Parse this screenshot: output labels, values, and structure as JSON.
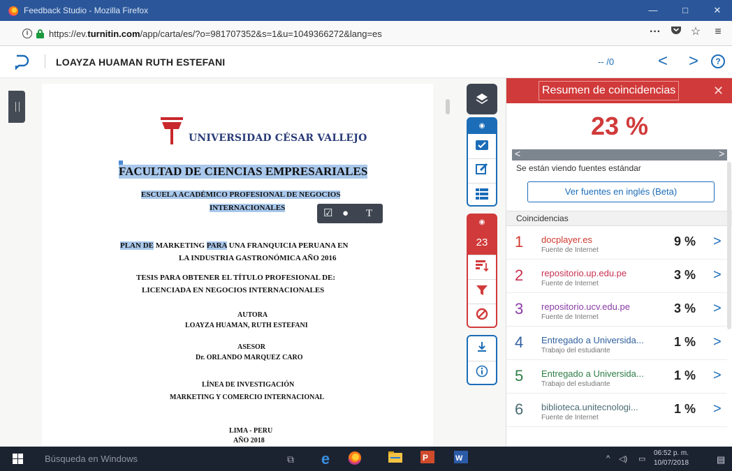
{
  "window": {
    "title": "Feedback Studio - Mozilla Firefox",
    "controls": {
      "minimize": "—",
      "maximize": "□",
      "close": "✕"
    }
  },
  "browser": {
    "url_prefix": "https://ev.",
    "url_domain": "turnitin.com",
    "url_suffix": "/app/carta/es/?o=981707352&s=1&u=1049366272&lang=es",
    "menu_dots": "···"
  },
  "header": {
    "student_name": "LOAYZA HUAMAN RUTH ESTEFANI",
    "page_indicator": "-- /0",
    "prev_label": "<",
    "next_label": ">",
    "help_label": "?"
  },
  "document": {
    "university": "UNIVERSIDAD CÉSAR VALLEJO",
    "faculty": "FACULTAD DE CIENCIAS EMPRESARIALES",
    "school_line1": "ESCUELA ACADÉMICO PROFESIONAL DE NEGOCIOS",
    "school_line2": "INTERNACIONALES",
    "plan_hl1": "PLAN DE",
    "plan_mid": " MARKETING ",
    "plan_hl2": "PARA",
    "plan_rest": " UNA FRANQUICIA PERUANA EN",
    "plan_line2": "LA INDUSTRIA GASTRONÓMICA AÑO 2016",
    "thesis_line1": "TESIS PARA OBTENER EL TÍTULO PROFESIONAL DE:",
    "thesis_line2": "LICENCIADA EN NEGOCIOS INTERNACIONALES",
    "author_label": "AUTORA",
    "author_name": "LOAYZA HUAMAN, RUTH ESTEFANI",
    "advisor_label": "ASESOR",
    "advisor_name": "Dr. ORLANDO MARQUEZ CARO",
    "line_label": "LÍNEA DE INVESTIGACIÓN",
    "line_name": "MARKETING Y COMERCIO INTERNACIONAL",
    "city": "LIMA - PERU",
    "year": "AÑO 2018",
    "mini_toolbar_text": "T"
  },
  "toolbar": {
    "similarity_count": "23"
  },
  "panel": {
    "title": "Resumen de coincidencias",
    "close": "✕",
    "percentage": "23 %",
    "nav_left": "<",
    "nav_right": ">",
    "standard_note": "Se están viendo fuentes estándar",
    "english_button": "Ver fuentes en inglés (Beta)",
    "matches_label": "Coincidencias",
    "matches": [
      {
        "num": "1",
        "source": "docplayer.es",
        "kind": "Fuente de Internet",
        "pct": "9 %",
        "color": "#d0392f"
      },
      {
        "num": "2",
        "source": "repositorio.up.edu.pe",
        "kind": "Fuente de Internet",
        "pct": "3 %",
        "color": "#c8314f"
      },
      {
        "num": "3",
        "source": "repositorio.ucv.edu.pe",
        "kind": "Fuente de Internet",
        "pct": "3 %",
        "color": "#8a3aa5"
      },
      {
        "num": "4",
        "source": "Entregado a Universida...",
        "kind": "Trabajo del estudiante",
        "pct": "1 %",
        "color": "#2f5f9e"
      },
      {
        "num": "5",
        "source": "Entregado a Universida...",
        "kind": "Trabajo del estudiante",
        "pct": "1 %",
        "color": "#2e7d45"
      },
      {
        "num": "6",
        "source": "biblioteca.unitecnologi...",
        "kind": "Fuente de Internet",
        "pct": "1 %",
        "color": "#4a6b74"
      }
    ]
  },
  "taskbar": {
    "search_placeholder": "Búsqueda en Windows",
    "time": "06:52 p. m.",
    "date": "10/07/2018"
  },
  "colors": {
    "accent_red": "#d13a3a",
    "accent_blue": "#1b6db8",
    "toolbar_dark": "#3e4551",
    "highlight": "#a9c8ec"
  }
}
